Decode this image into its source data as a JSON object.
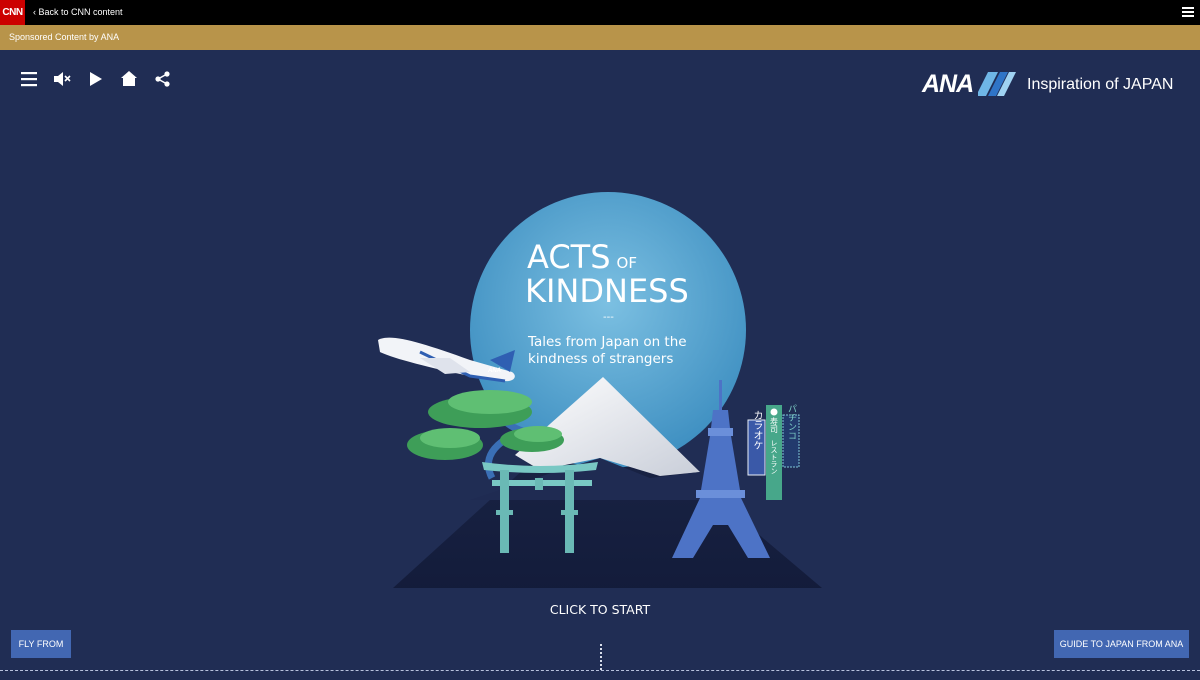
{
  "topbar": {
    "logo_text": "CNN",
    "back_label": "‹ Back to CNN content",
    "menu_icon": "hamburger-icon"
  },
  "sponsor": {
    "text": "Sponsored Content by ANA"
  },
  "toolbar": {
    "icons": [
      "menu-icon",
      "mute-icon",
      "play-icon",
      "home-icon",
      "share-icon"
    ]
  },
  "brand": {
    "logo_text": "ANA",
    "tagline": "Inspiration of JAPAN"
  },
  "hero": {
    "title_line1": "ACTS",
    "title_of": "OF",
    "title_line2": "KINDNESS",
    "divider": "---",
    "subtitle": "Tales from Japan on the kindness of strangers",
    "plane_label": "ANA",
    "sign_karaoke": "カラオケ",
    "sign_sushi": "寿司",
    "sign_restaurant": "レストラン",
    "sign_pachinko": "パチンコ"
  },
  "cta": {
    "start_label": "CLICK TO START"
  },
  "buttons": {
    "fly_from": "FLY FROM",
    "guide": "GUIDE TO JAPAN FROM ANA"
  },
  "colors": {
    "background": "#202d54",
    "sponsor_bar": "#b8944a",
    "cnn_red": "#cc0000",
    "button_blue": "#4267b2",
    "moon": "#5fa8d3"
  }
}
